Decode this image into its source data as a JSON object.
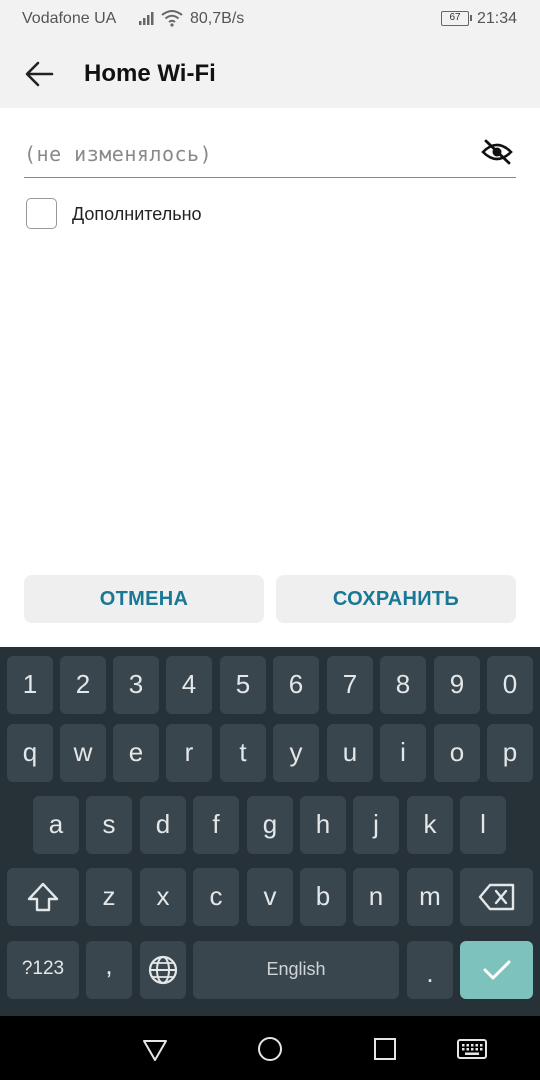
{
  "status_bar": {
    "carrier": "Vodafone UA",
    "speed": "80,7B/s",
    "battery_level": 67,
    "battery_text": "67",
    "time": "21:34"
  },
  "header": {
    "title": "Home Wi-Fi",
    "back_icon": "arrow-left-icon"
  },
  "password_field": {
    "placeholder": "(не изменялось)",
    "value": "",
    "toggle_icon": "eye-off-icon"
  },
  "advanced": {
    "label": "Дополнительно",
    "checked": false
  },
  "actions": {
    "cancel_label": "ОТМЕНА",
    "save_label": "СОХРАНИТЬ"
  },
  "keyboard": {
    "number_row": [
      "1",
      "2",
      "3",
      "4",
      "5",
      "6",
      "7",
      "8",
      "9",
      "0"
    ],
    "row1": [
      "q",
      "w",
      "e",
      "r",
      "t",
      "y",
      "u",
      "i",
      "o",
      "p"
    ],
    "row2": [
      "a",
      "s",
      "d",
      "f",
      "g",
      "h",
      "j",
      "k",
      "l"
    ],
    "row3": [
      "z",
      "x",
      "c",
      "v",
      "b",
      "n",
      "m"
    ],
    "symbols_label": "?123",
    "comma": ",",
    "space_label": "English",
    "period": ".",
    "icons": {
      "shift": "shift-icon",
      "backspace": "backspace-icon",
      "language": "globe-icon",
      "done": "checkmark-icon"
    },
    "done_color": "#7ec2bd"
  },
  "nav_bar": {
    "icons": [
      "back-triangle-icon",
      "home-circle-icon",
      "recents-square-icon",
      "keyboard-icon"
    ]
  },
  "colors": {
    "accent": "#1a7896",
    "keyboard_bg": "#263238",
    "key_bg": "#3a464d"
  }
}
